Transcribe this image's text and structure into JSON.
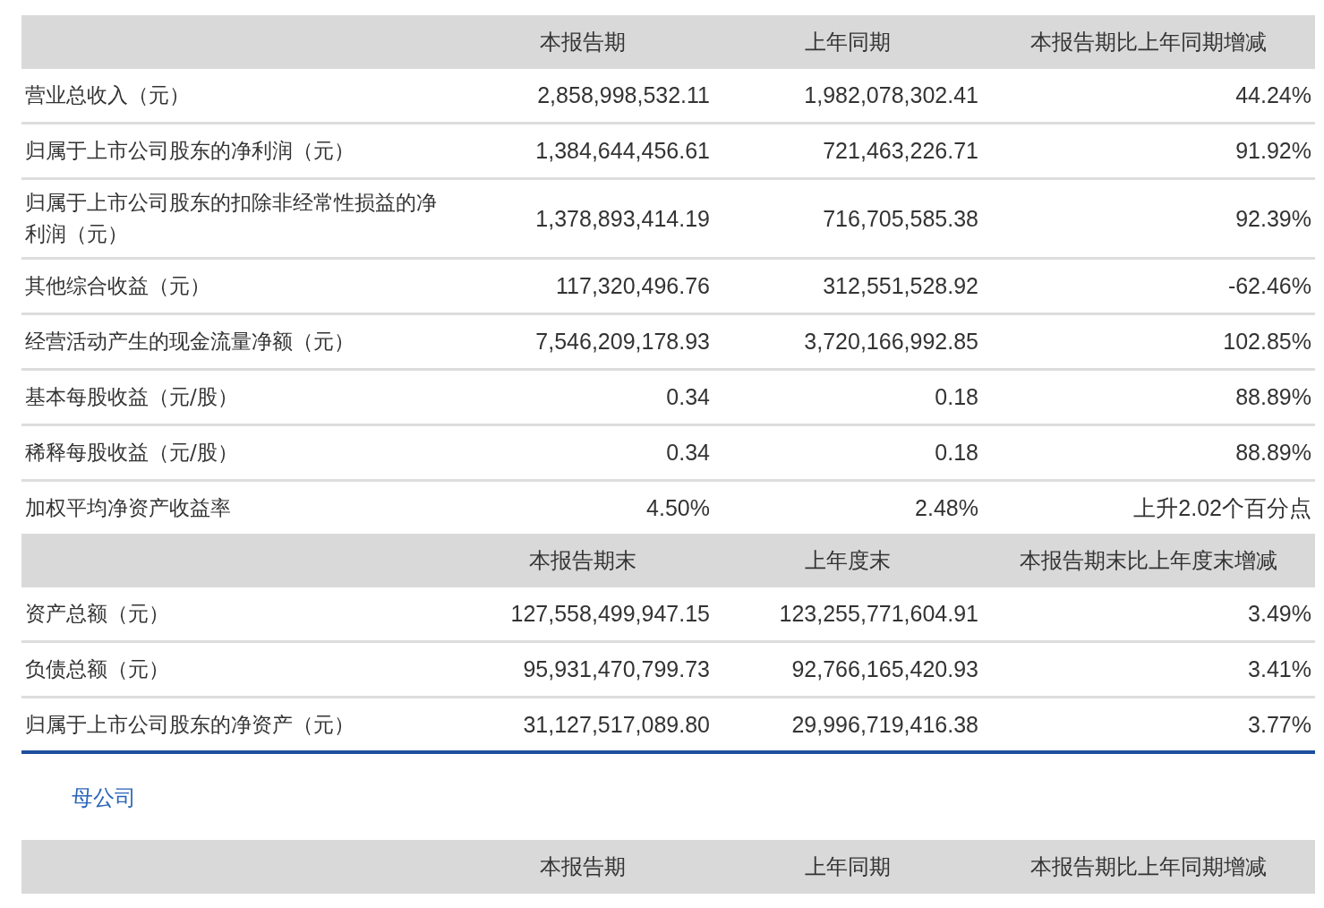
{
  "table": {
    "blocks": [
      {
        "columns": [
          "本报告期",
          "上年同期",
          "本报告期比上年同期增减"
        ],
        "rows": [
          {
            "label": "营业总收入（元）",
            "values": [
              "2,858,998,532.11",
              "1,982,078,302.41",
              "44.24%"
            ]
          },
          {
            "label": "归属于上市公司股东的净利润（元）",
            "values": [
              "1,384,644,456.61",
              "721,463,226.71",
              "91.92%"
            ]
          },
          {
            "label": "归属于上市公司股东的扣除非经常性损益的净利润（元）",
            "values": [
              "1,378,893,414.19",
              "716,705,585.38",
              "92.39%"
            ]
          },
          {
            "label": "其他综合收益（元）",
            "values": [
              "117,320,496.76",
              "312,551,528.92",
              "-62.46%"
            ]
          },
          {
            "label": "经营活动产生的现金流量净额（元）",
            "values": [
              "7,546,209,178.93",
              "3,720,166,992.85",
              "102.85%"
            ]
          },
          {
            "label": "基本每股收益（元/股）",
            "values": [
              "0.34",
              "0.18",
              "88.89%"
            ]
          },
          {
            "label": "稀释每股收益（元/股）",
            "values": [
              "0.34",
              "0.18",
              "88.89%"
            ]
          },
          {
            "label": "加权平均净资产收益率",
            "values": [
              "4.50%",
              "2.48%",
              "上升2.02个百分点"
            ]
          }
        ]
      },
      {
        "columns": [
          "本报告期末",
          "上年度末",
          "本报告期末比上年度末增减"
        ],
        "rows": [
          {
            "label": "资产总额（元）",
            "values": [
              "127,558,499,947.15",
              "123,255,771,604.91",
              "3.49%"
            ]
          },
          {
            "label": "负债总额（元）",
            "values": [
              "95,931,470,799.73",
              "92,766,165,420.93",
              "3.41%"
            ]
          },
          {
            "label": "归属于上市公司股东的净资产（元）",
            "values": [
              "31,127,517,089.80",
              "29,996,719,416.38",
              "3.77%"
            ]
          }
        ]
      }
    ]
  },
  "section_title": "母公司",
  "table_2": {
    "columns": [
      "本报告期",
      "上年同期",
      "本报告期比上年同期增减"
    ]
  }
}
